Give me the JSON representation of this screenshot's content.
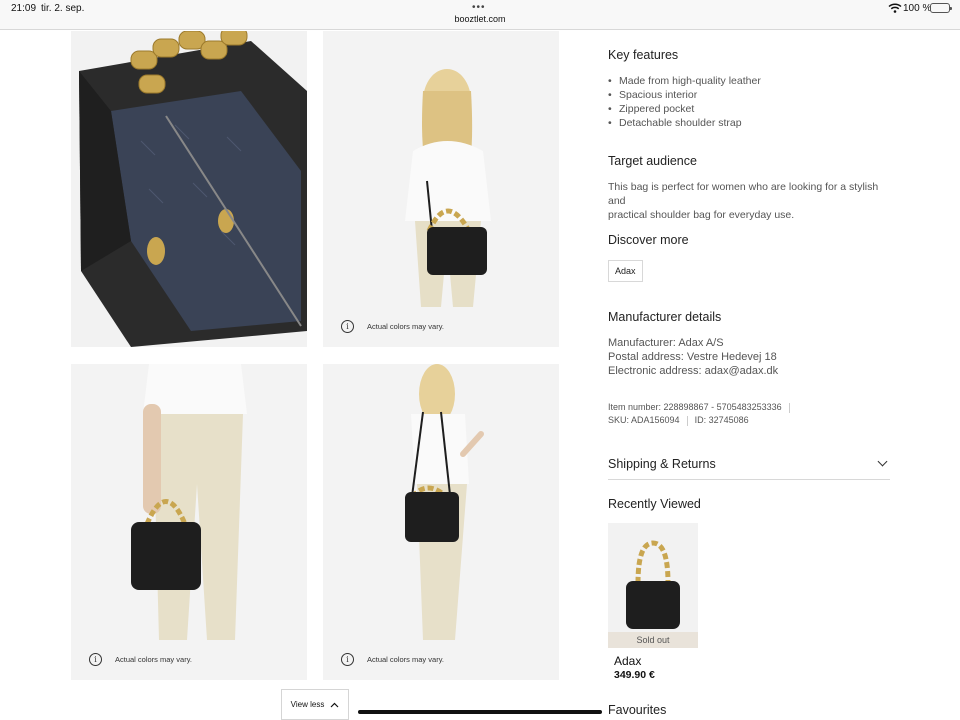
{
  "status_bar": {
    "time": "21:09",
    "date": "tir. 2. sep.",
    "url": "booztlet.com",
    "battery_pct": "100 %"
  },
  "gallery": {
    "caption": "Actual colors may vary.",
    "view_less": "View less"
  },
  "details": {
    "key_features_title": "Key features",
    "key_features": [
      "Made from high-quality leather",
      "Spacious interior",
      "Zippered pocket",
      "Detachable shoulder strap"
    ],
    "target_audience_title": "Target audience",
    "target_audience_text_1": "This bag is perfect for women who are looking for a stylish and",
    "target_audience_text_2": "practical shoulder bag for everyday use.",
    "discover_more_title": "Discover more",
    "discover_tag": "Adax",
    "manufacturer_title": "Manufacturer details",
    "manufacturer": "Manufacturer: Adax A/S",
    "postal": "Postal address: Vestre Hedevej 18",
    "electronic": "Electronic address: adax@adax.dk",
    "item_number": "Item number: 228898867 - 5705483253336",
    "sku": "SKU: ADA156094",
    "id": "ID: 32745086",
    "shipping_title": "Shipping & Returns",
    "recently_viewed_title": "Recently Viewed",
    "rv_sold_out": "Sold out",
    "rv_brand": "Adax",
    "rv_price": "349.90 €",
    "favourites_title": "Favourites"
  },
  "icons": {
    "info": "info-icon",
    "chevron_up": "chevron-up-icon",
    "chevron_down": "chevron-down-icon",
    "wifi": "wifi-icon",
    "battery": "battery-icon"
  },
  "colors": {
    "bag": "#1e1e1e",
    "gold_chain": "#c9a650",
    "tile_bg": "#f3f3f3",
    "sold_out_bg": "#e9e3da",
    "battery_green": "#34c759"
  }
}
